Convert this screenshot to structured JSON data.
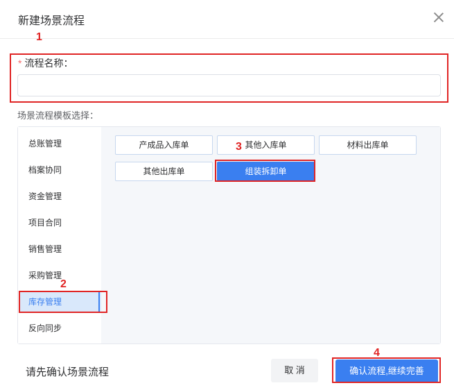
{
  "dialog": {
    "title": "新建场景流程"
  },
  "form": {
    "name_label": "流程名称：",
    "required_mark": "*",
    "name_value": "",
    "name_placeholder": "",
    "template_label": "场景流程模板选择："
  },
  "sidebar": {
    "items": [
      {
        "label": "总账管理"
      },
      {
        "label": "档案协同"
      },
      {
        "label": "资金管理"
      },
      {
        "label": "项目合同"
      },
      {
        "label": "销售管理"
      },
      {
        "label": "采购管理"
      },
      {
        "label": "库存管理"
      },
      {
        "label": "反向同步"
      }
    ],
    "active_index": 6
  },
  "templates": [
    {
      "label": "产成品入库单"
    },
    {
      "label": "其他入库单"
    },
    {
      "label": "材料出库单"
    },
    {
      "label": "其他出库单"
    },
    {
      "label": "组装拆卸单"
    }
  ],
  "annotations": [
    "1",
    "2",
    "3",
    "4"
  ],
  "footer": {
    "hint": "请先确认场景流程",
    "cancel_label": "取 消",
    "confirm_label": "确认流程,继续完善"
  },
  "colors": {
    "primary": "#3a7ff0",
    "annotation": "#e02424",
    "required": "#f56c6c"
  }
}
